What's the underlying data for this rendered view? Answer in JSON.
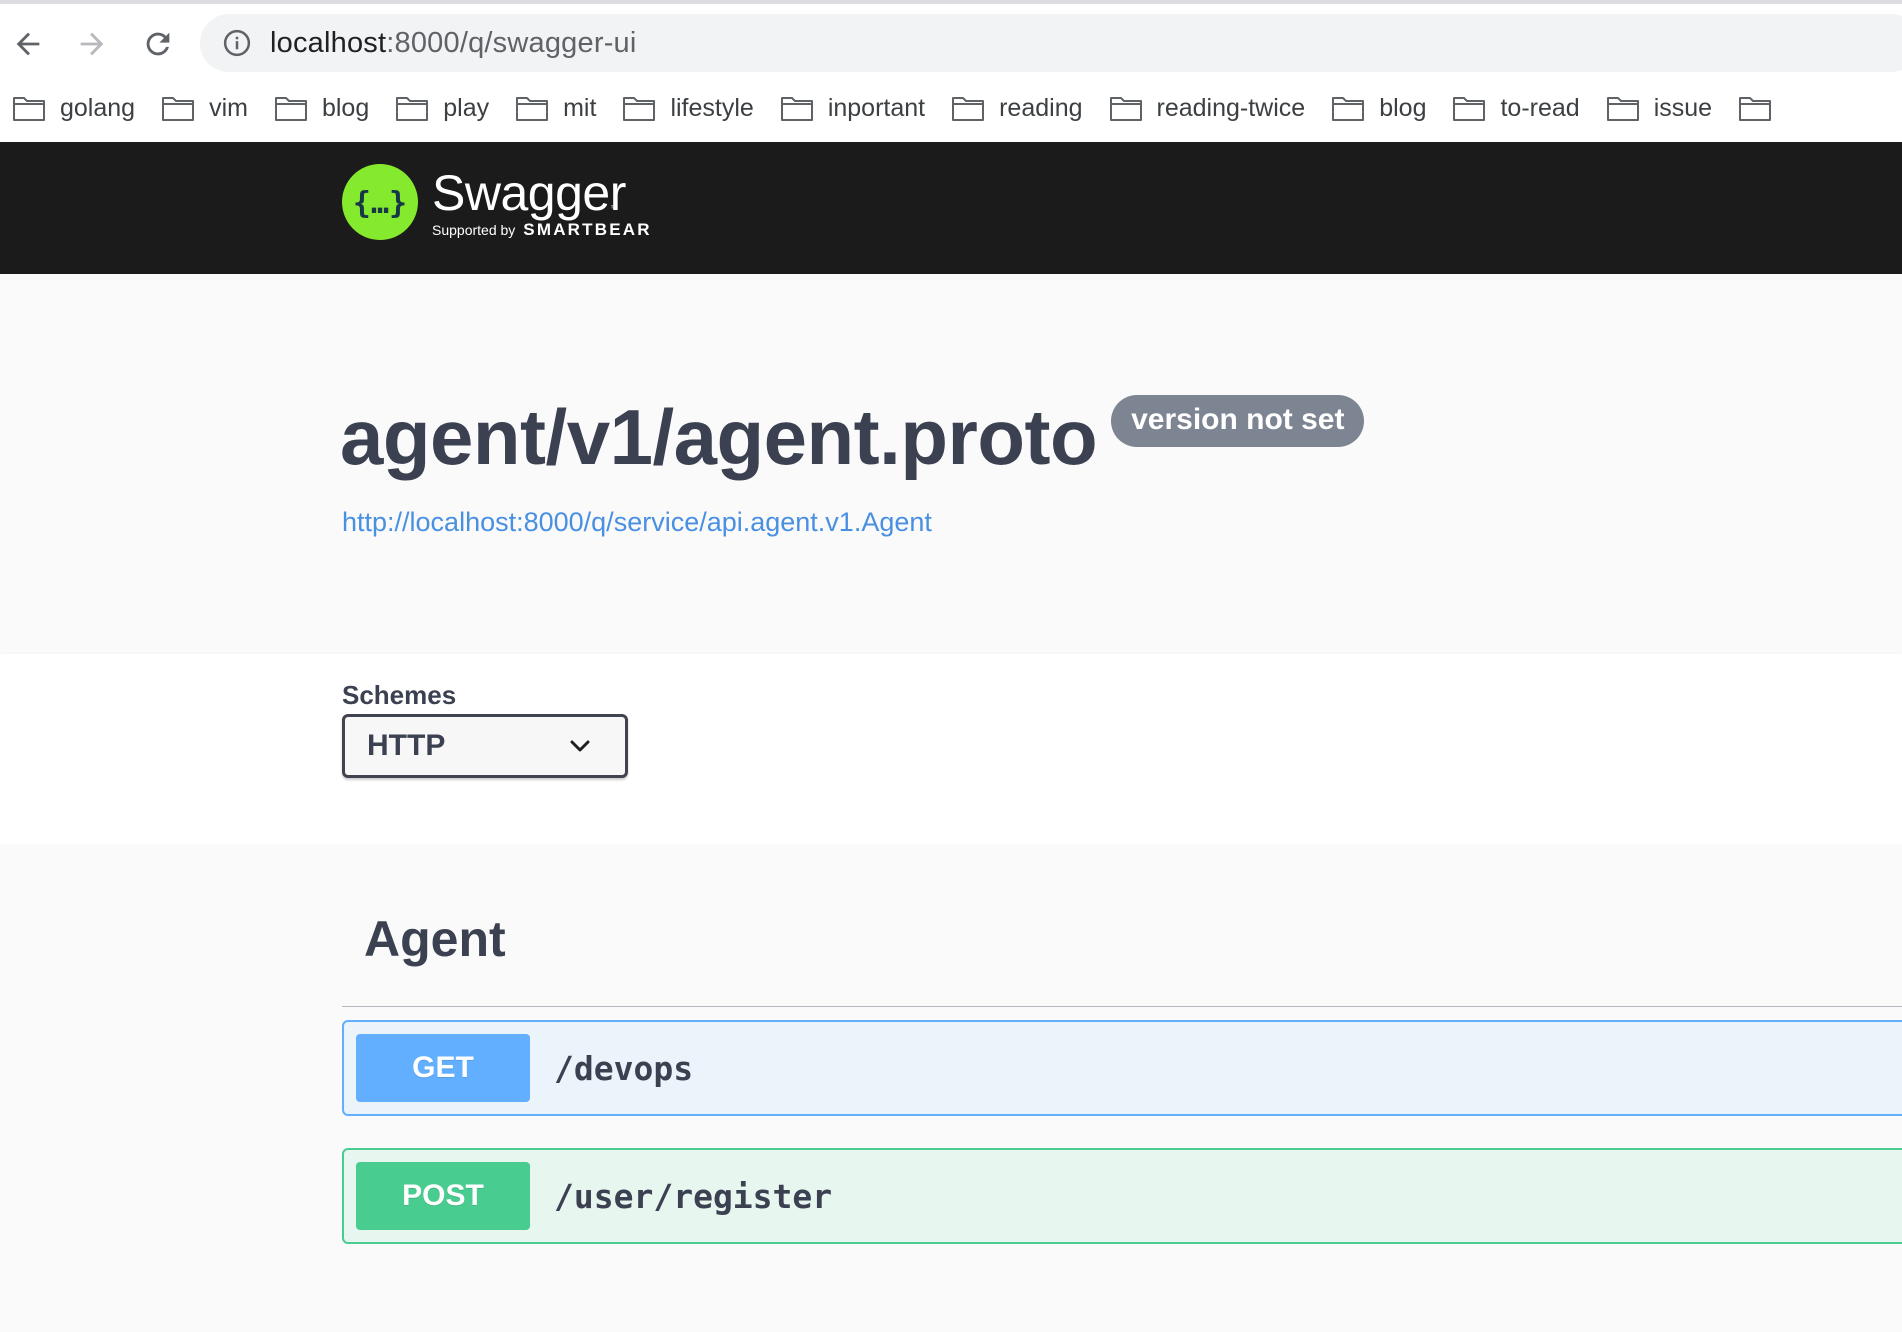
{
  "browser": {
    "url_host": "localhost",
    "url_rest": ":8000/q/swagger-ui",
    "bookmarks": [
      "golang",
      "vim",
      "blog",
      "play",
      "mit",
      "lifestyle",
      "inportant",
      "reading",
      "reading-twice",
      "blog",
      "to-read",
      "issue",
      ""
    ]
  },
  "topbar": {
    "brand": "Swagger",
    "tm": "™",
    "supported_by": "Supported by",
    "company": "SMARTBEAR"
  },
  "info": {
    "title": "agent/v1/agent.proto",
    "version": "version not set",
    "url": "http://localhost:8000/q/service/api.agent.v1.Agent"
  },
  "schemes": {
    "label": "Schemes",
    "selected": "HTTP"
  },
  "tag": {
    "name": "Agent",
    "operations": [
      {
        "method": "GET",
        "path": "/devops",
        "color": "#61affe"
      },
      {
        "method": "POST",
        "path": "/user/register",
        "color": "#49cc90"
      }
    ]
  },
  "colors": {
    "topbar_bg": "#1b1b1b",
    "logo_green": "#85ea2d",
    "link_blue": "#4990e2",
    "badge_gray": "#7d8492"
  }
}
